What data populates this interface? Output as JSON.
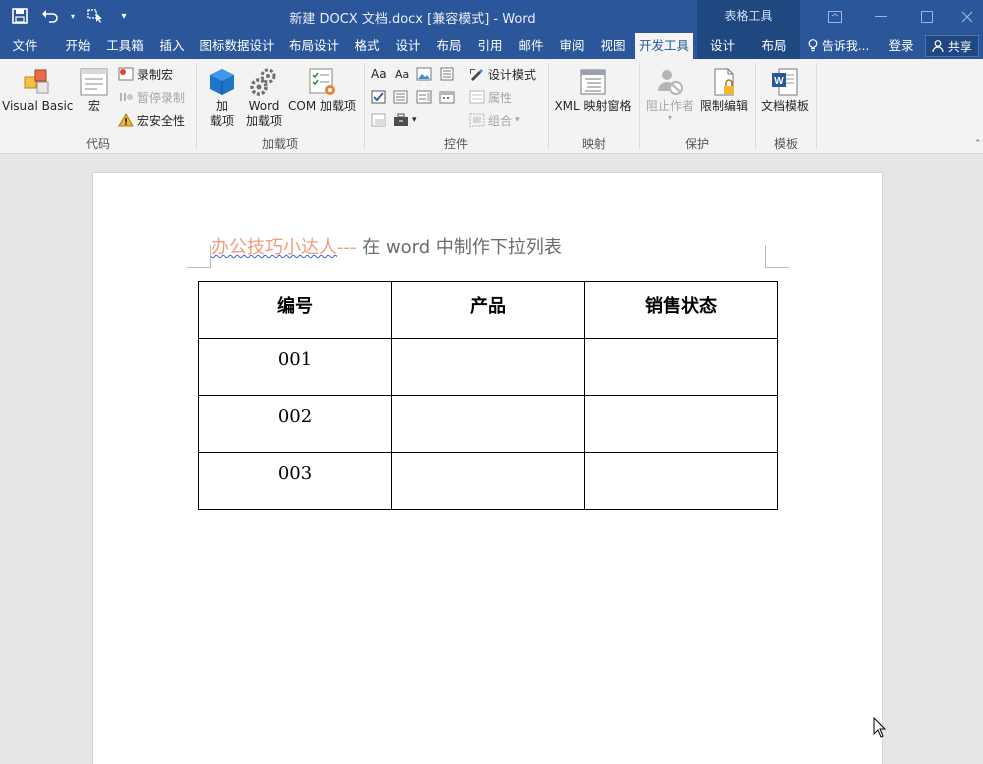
{
  "window": {
    "title": "新建 DOCX 文档.docx [兼容模式] - Word",
    "context_group": "表格工具",
    "minimize_icon": "minimize-icon",
    "maximize_icon": "maximize-icon",
    "close_icon": "close-icon"
  },
  "qat": {
    "save_icon": "save-icon",
    "undo_icon": "undo-icon",
    "touch_icon": "touch-mode-icon",
    "customize_icon": "customize-icon"
  },
  "tabs": [
    {
      "label": "文件"
    },
    {
      "label": "开始"
    },
    {
      "label": "工具箱"
    },
    {
      "label": "插入"
    },
    {
      "label": "图标数据设计"
    },
    {
      "label": "布局设计"
    },
    {
      "label": "格式"
    },
    {
      "label": "设计"
    },
    {
      "label": "布局"
    },
    {
      "label": "引用"
    },
    {
      "label": "邮件"
    },
    {
      "label": "审阅"
    },
    {
      "label": "视图"
    },
    {
      "label": "开发工具"
    },
    {
      "label": "设计"
    },
    {
      "label": "布局"
    }
  ],
  "active_tab": "开发工具",
  "tell_me": "告诉我...",
  "login": "登录",
  "share": "共享",
  "ribbon": {
    "code": {
      "label": "代码",
      "visual_basic": "Visual Basic",
      "macros": "宏",
      "record_macro": "录制宏",
      "pause_recording": "暂停录制",
      "macro_security": "宏安全性"
    },
    "addins": {
      "label": "加载项",
      "addins": "加\n载项",
      "addins_l1": "加",
      "addins_l2": "载项",
      "word_addins_l1": "Word",
      "word_addins_l2": "加载项",
      "com_addins": "COM 加载项"
    },
    "controls": {
      "label": "控件",
      "design_mode": "设计模式",
      "properties": "属性",
      "group": "组合"
    },
    "mapping": {
      "label": "映射",
      "xml_pane": "XML 映射窗格"
    },
    "protect": {
      "label": "保护",
      "block_authors": "阻止作者",
      "restrict_editing": "限制编辑"
    },
    "templates": {
      "label": "模板",
      "doc_template": "文档模板"
    }
  },
  "document": {
    "title_accent": "办公技巧小达人",
    "title_accent_dash": "---",
    "title_rest": " 在 word 中制作下拉列表",
    "table": {
      "headers": [
        "编号",
        "产品",
        "销售状态"
      ],
      "rows": [
        [
          "001",
          "",
          ""
        ],
        [
          "002",
          "",
          ""
        ],
        [
          "003",
          "",
          ""
        ]
      ]
    }
  },
  "colors": {
    "title_bar": "#2b579a",
    "accent_text": "#f29a7e",
    "ribbon_bg": "#f3f3f3"
  }
}
